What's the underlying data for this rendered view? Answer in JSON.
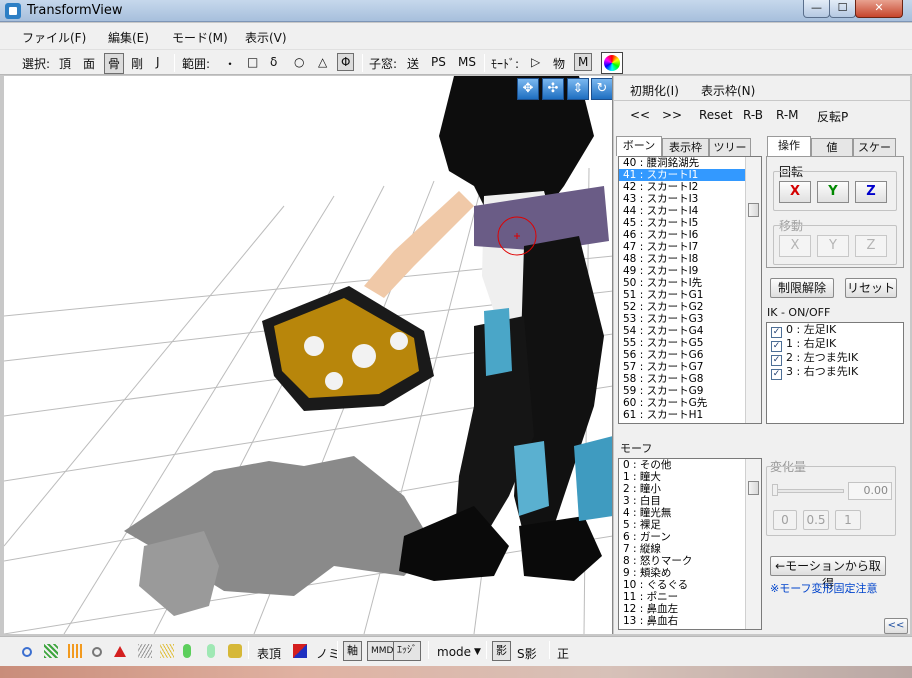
{
  "window": {
    "title": "TransformView",
    "min": "—",
    "max": "☐",
    "close": "✕"
  },
  "menu": [
    "ファイル(F)",
    "編集(E)",
    "モード(M)",
    "表示(V)"
  ],
  "toolbar": {
    "select_label": "選択:",
    "select_items": [
      "頂",
      "面",
      "骨",
      "剛",
      "J"
    ],
    "range_label": "範囲:",
    "range_items": [
      "・",
      "□",
      "δ",
      "○",
      "△",
      "Φ"
    ],
    "child_label": "子窓:",
    "child_items": [
      "送",
      "PS",
      "MS"
    ],
    "mode_label": "ﾓｰﾄﾞ:",
    "mode_items": [
      "▷",
      "物",
      "M"
    ]
  },
  "right_panel": {
    "init_label": "初期化(I)",
    "display_frame_label": "表示枠(N)",
    "nav_prev": "<<",
    "nav_next": ">>",
    "reset": "Reset",
    "rb": "R-B",
    "rm": "R-M",
    "invert": "反転P",
    "bone_tabs": [
      "ボーン",
      "表示枠",
      "ツリー"
    ],
    "bones": [
      "40 : 腰洞銘湖先",
      "41 : スカートI1",
      "42 : スカートI2",
      "43 : スカートI3",
      "44 : スカートI4",
      "45 : スカートI5",
      "46 : スカートI6",
      "47 : スカートI7",
      "48 : スカートI8",
      "49 : スカートI9",
      "50 : スカートI先",
      "51 : スカートG1",
      "52 : スカートG2",
      "53 : スカートG3",
      "54 : スカートG4",
      "55 : スカートG5",
      "56 : スカートG6",
      "57 : スカートG7",
      "58 : スカートG8",
      "59 : スカートG9",
      "60 : スカートG先",
      "61 : スカートH1"
    ],
    "op_tabs": [
      "操作",
      "値",
      "スケール"
    ],
    "rotate_label": "回転",
    "move_label": "移動",
    "axes": [
      "X",
      "Y",
      "Z"
    ],
    "unlock_limit": "制限解除",
    "reset_btn": "リセット",
    "ik_title": "IK - ON/OFF",
    "ik_items": [
      "0 : 左足IK",
      "1 : 右足IK",
      "2 : 左つま先IK",
      "3 : 右つま先IK"
    ],
    "morph_title": "モーフ",
    "morphs": [
      "0 : その他",
      "1 : 瞳大",
      "2 : 瞳小",
      "3 : 白目",
      "4 : 瞳光無",
      "5 : 裸足",
      "6 : ガーン",
      "7 : 縦線",
      "8 : 怒りマーク",
      "9 : 頬染め",
      "10 : ぐるぐる",
      "11 : ポニー",
      "12 : 鼻血左",
      "13 : 鼻血右"
    ],
    "change_label": "変化量",
    "change_value": "0.00",
    "change_buttons": [
      "0",
      "0.5",
      "1"
    ],
    "from_motion": "←モーションから取得",
    "morph_note": "※モーフ変形固定注意",
    "collapse": "<<"
  },
  "statusbar": {
    "table_top": "表頂",
    "nomi": "ノミ",
    "axis": "軸",
    "mmd": "MMD",
    "edge": "ｴｯｼﾞ",
    "mode": "mode",
    "shadow": "影",
    "s_shadow": "S影",
    "correct": "正"
  },
  "colors": {
    "accent": "#3399ff",
    "x_axis": "#d40000",
    "y_axis": "#008800",
    "z_axis": "#0000cc",
    "note": "#0044cc"
  }
}
